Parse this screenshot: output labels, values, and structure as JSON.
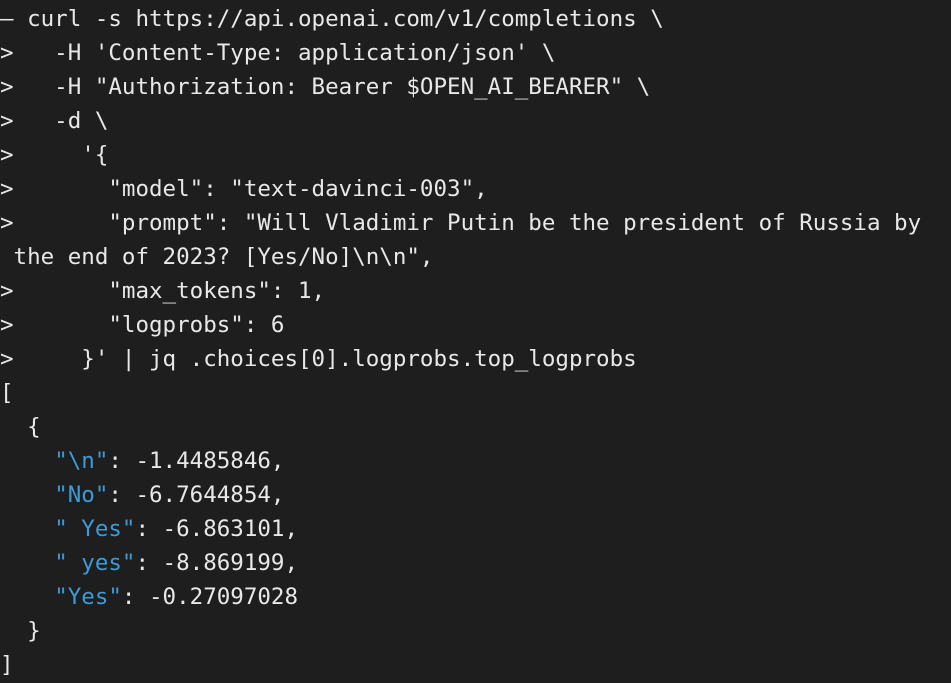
{
  "colors": {
    "background": "#1e1e1e",
    "text": "#e8e8e8",
    "json_key": "#3e9ad6"
  },
  "terminal": {
    "command_lines": [
      "— curl -s https://api.openai.com/v1/completions \\",
      ">   -H 'Content-Type: application/json' \\",
      ">   -H \"Authorization: Bearer $OPEN_AI_BEARER\" \\",
      ">   -d \\",
      ">     '{",
      ">       \"model\": \"text-davinci-003\",",
      ">       \"prompt\": \"Will Vladimir Putin be the president of Russia by",
      " the end of 2023? [Yes/No]\\n\\n\",",
      ">       \"max_tokens\": 1,",
      ">       \"logprobs\": 6",
      ">     }' | jq .choices[0].logprobs.top_logprobs"
    ],
    "output": {
      "open_bracket": "[",
      "open_brace": "  {",
      "entries": [
        {
          "indent": "    ",
          "key": "\"\\n\"",
          "value": ": -1.4485846,"
        },
        {
          "indent": "    ",
          "key": "\"No\"",
          "value": ": -6.7644854,"
        },
        {
          "indent": "    ",
          "key": "\" Yes\"",
          "value": ": -6.863101,"
        },
        {
          "indent": "    ",
          "key": "\" yes\"",
          "value": ": -8.869199,"
        },
        {
          "indent": "    ",
          "key": "\"Yes\"",
          "value": ": -0.27097028"
        }
      ],
      "close_brace": "  }",
      "close_bracket": "]"
    }
  }
}
